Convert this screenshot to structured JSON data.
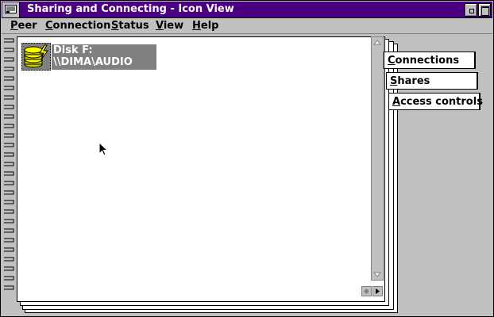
{
  "window": {
    "title": "Sharing and Connecting - Icon View"
  },
  "menu": {
    "items": [
      {
        "label_first": "P",
        "label_rest": "eer"
      },
      {
        "label_first": "C",
        "label_rest": "onnection"
      },
      {
        "label_first": "S",
        "label_rest": "tatus"
      },
      {
        "label_first": "V",
        "label_rest": "iew"
      },
      {
        "label_first": "H",
        "label_rest": "elp"
      }
    ]
  },
  "tabs": [
    {
      "label_first": "C",
      "label_rest": "onnections"
    },
    {
      "label_first": "S",
      "label_rest": "hares"
    },
    {
      "label_first": "A",
      "label_rest": "ccess controls"
    }
  ],
  "items": [
    {
      "line1": "Disk F:",
      "line2": "\\\\DIMA\\AUDIO",
      "icon": "disk-drive-icon"
    }
  ],
  "colors": {
    "titlebar": "#4b0082",
    "face": "#c0c0c0",
    "selection": "#808080"
  }
}
